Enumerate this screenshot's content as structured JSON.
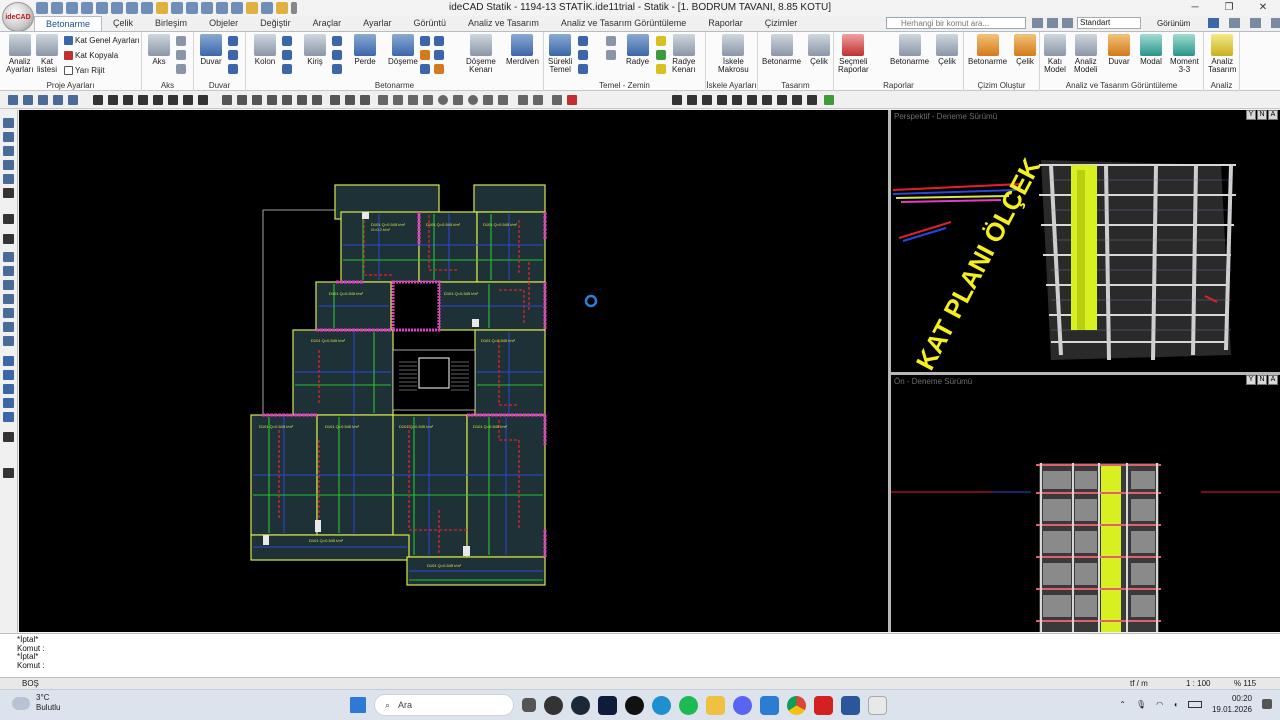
{
  "window": {
    "title": "ideCAD Statik - 1194-13 STATİK.ide11trial - Statik - [1. BODRUM TAVANI,  8.85 KOTU]",
    "logo_text": "ideCAD"
  },
  "tabs": [
    "Betonarme",
    "Çelik",
    "Birleşim",
    "Objeler",
    "Değiştir",
    "Araçlar",
    "Ayarlar",
    "Görüntü",
    "Analiz ve Tasarım",
    "Analiz ve Tasarım Görüntüleme",
    "Raporlar",
    "Çizimler"
  ],
  "search": {
    "placeholder": "Herhangi bir komut ara..."
  },
  "right_tools": {
    "standard": "Standart",
    "view": "Görünüm"
  },
  "ribbon": {
    "proje": {
      "label": "Proje Ayarları",
      "analiz": "Analiz\nAyarları",
      "kat_listesi": "Kat\nlistesi",
      "kat_genel": "Kat Genel Ayarları",
      "kat_kopyala": "Kat Kopyala",
      "yari_rijit": "Yarı Rijit"
    },
    "aks": {
      "label": "Aks",
      "aks": "Aks"
    },
    "duvar": {
      "label": "Duvar",
      "duvar": "Duvar"
    },
    "betonarme": {
      "label": "Betonarme",
      "kolon": "Kolon",
      "kiris": "Kiriş",
      "perde": "Perde",
      "doseme": "Döşeme",
      "doseme_kenari": "Döşeme\nKenarı",
      "merdiven": "Merdiven"
    },
    "temel": {
      "label": "Temel - Zemin",
      "surekli_temel": "Sürekli\nTemel",
      "radye": "Radye",
      "radye_kenari": "Radye\nKenarı"
    },
    "iskele": {
      "label": "İskele Ayarları",
      "iskele_makrosu": "İskele\nMakrosu"
    },
    "tasarim": {
      "label": "Tasarım",
      "betonarme": "Betonarme",
      "celik": "Çelik"
    },
    "raporlar": {
      "label": "Raporlar",
      "secmeli": "Seçmeli\nRaporlar",
      "betonarme": "Betonarme",
      "celik": "Çelik"
    },
    "cizim": {
      "label": "Çizim Oluştur",
      "betonarme": "Betonarme",
      "celik": "Çelik"
    },
    "goruntuleme": {
      "label": "Analiz ve Tasarım Görüntüleme",
      "kati_model": "Katı\nModel",
      "analiz_modeli": "Analiz\nModeli",
      "duvar": "Duvar",
      "modal": "Modal",
      "moment": "Moment\n3-3"
    },
    "analiz": {
      "label": "Analiz",
      "analiz_tasarim": "Analiz\nTasarım"
    }
  },
  "viewports": {
    "persp_title": "Perspektif - Deneme Sürümü",
    "front_title": "Ön - Deneme Sürümü",
    "kat_plani_text": "KAT PLANI ÖLÇEK",
    "slab_label_1": "D101  Q=0.545 t/m²",
    "slab_label_2": "G=0.2 t/m²"
  },
  "command": {
    "lines": [
      "*İptal*",
      "Komut :",
      "*İptal*",
      "Komut :"
    ]
  },
  "status": {
    "left": "BOŞ",
    "units": "tf / m",
    "scale": "1 : 100",
    "zoom": "% 115"
  },
  "taskbar": {
    "weather_temp": "3°C",
    "weather_desc": "Bulutlu",
    "search_label": "Ara",
    "time": "00:20",
    "date": "19.01.2026"
  },
  "colors": {
    "accent": "#1a4f9c",
    "cad_bg": "#000000",
    "slab_fill": "#1e3136",
    "beam_yellow": "#d8e84a",
    "rebar_red": "#e0202a",
    "rebar_blue": "#2c46d8",
    "rebar_green": "#23c430",
    "column_magenta": "#e23cc8"
  }
}
